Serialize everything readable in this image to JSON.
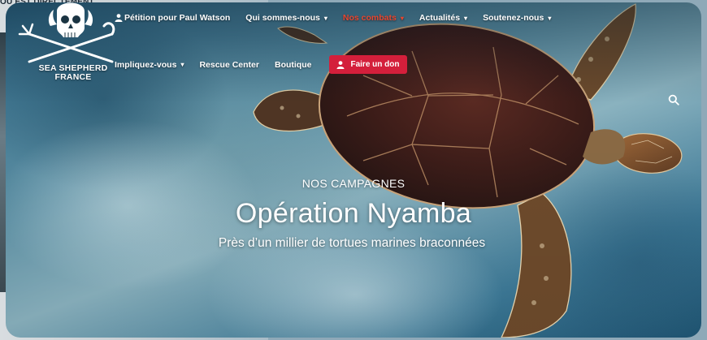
{
  "background": {
    "snippet_text": "OU EST DIRECTEMENT"
  },
  "brand": {
    "name_line1": "SEA SHEPHERD",
    "name_line2": "FRANCE",
    "logo_icon": "skull-crossed-trident-shepherd-staff-icon"
  },
  "nav": {
    "row1": [
      {
        "label": "Pétition pour Paul Watson",
        "icon": "person-icon",
        "dropdown": false,
        "active": false
      },
      {
        "label": "Qui sommes-nous",
        "dropdown": true,
        "active": false
      },
      {
        "label": "Nos combats",
        "dropdown": true,
        "active": true
      },
      {
        "label": "Actualités",
        "dropdown": true,
        "active": false
      },
      {
        "label": "Soutenez-nous",
        "dropdown": true,
        "active": false
      }
    ],
    "row2": [
      {
        "label": "Impliquez-vous",
        "dropdown": true
      },
      {
        "label": "Rescue Center",
        "dropdown": false
      },
      {
        "label": "Boutique",
        "dropdown": false
      }
    ],
    "donate_label": "Faire un don",
    "search_icon": "search-icon"
  },
  "hero": {
    "kicker": "NOS CAMPAGNES",
    "title": "Opération Nyamba",
    "subtitle": "Près d’un millier de tortues marines braconnées"
  },
  "colors": {
    "accent_active": "#e8452e",
    "donate_bg": "#d41f3b",
    "text": "#ffffff"
  }
}
